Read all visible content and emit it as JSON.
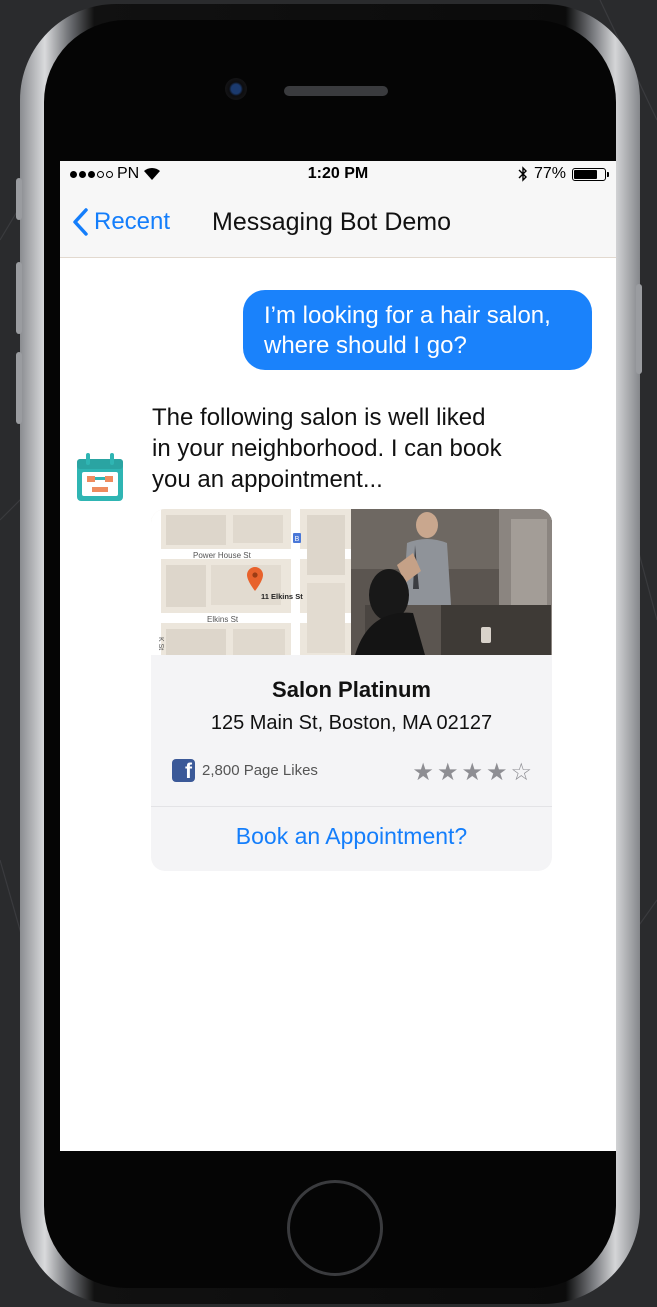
{
  "statusbar": {
    "carrier": "PN",
    "time": "1:20 PM",
    "battery": "77%",
    "battery_level": 0.77,
    "icons": [
      "signal-dots-icon",
      "wifi-icon",
      "bluetooth-icon",
      "battery-icon"
    ]
  },
  "navbar": {
    "back_label": "Recent",
    "title": "Messaging Bot Demo",
    "accent": "#147efb"
  },
  "messages": {
    "user_line1": "I’m looking for a hair salon,",
    "user_line2": "where should I go?",
    "bot_line1": "The following salon is well liked",
    "bot_line2": "in your neighborhood. I can book",
    "bot_line3": "you an appointment..."
  },
  "card": {
    "map": {
      "street1": "Power House St",
      "pin_label": "11 Elkins St",
      "street2": "Elkins St",
      "street3": "K St",
      "transit": "B"
    },
    "name": "Salon Platinum",
    "address": "125 Main St, Boston, MA 02127",
    "likes": "2,800 Page Likes",
    "rating": 4,
    "rating_max": 5,
    "cta": "Book an Appointment?"
  },
  "colors": {
    "bubble": "#1a82fb",
    "fb_blue": "#3b5998",
    "map_pin": "#e8622c",
    "bot_icon": "#2fb5b3"
  }
}
